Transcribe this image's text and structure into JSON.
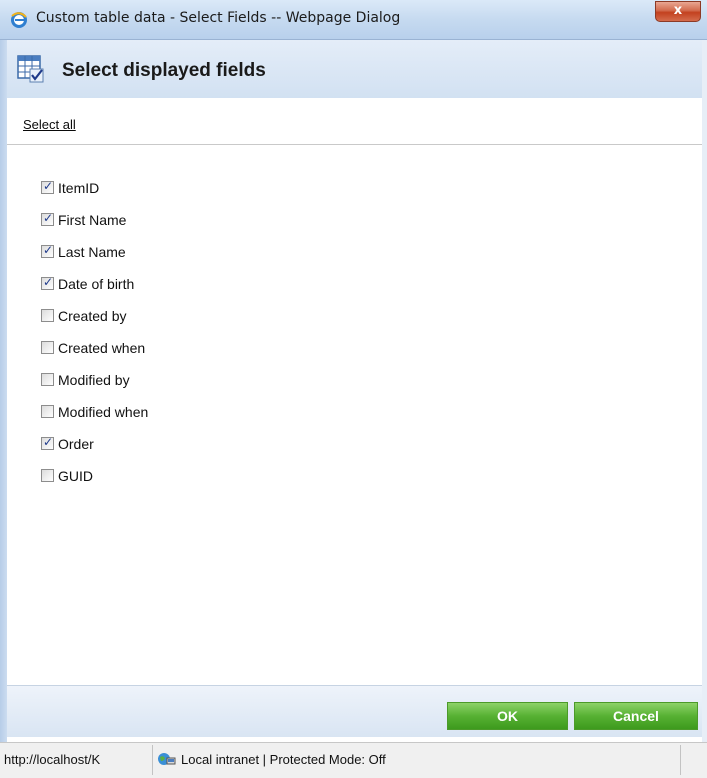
{
  "window": {
    "title": "Custom table data - Select Fields -- Webpage Dialog",
    "close_label": "x"
  },
  "dialog": {
    "title": "Select displayed fields",
    "select_all": "Select all"
  },
  "fields": [
    {
      "label": "ItemID",
      "checked": true
    },
    {
      "label": "First Name",
      "checked": true
    },
    {
      "label": "Last Name",
      "checked": true
    },
    {
      "label": "Date of birth",
      "checked": true
    },
    {
      "label": "Created by",
      "checked": false
    },
    {
      "label": "Created when",
      "checked": false
    },
    {
      "label": "Modified by",
      "checked": false
    },
    {
      "label": "Modified when",
      "checked": false
    },
    {
      "label": "Order",
      "checked": true
    },
    {
      "label": "GUID",
      "checked": false
    }
  ],
  "footer": {
    "ok_label": "OK",
    "cancel_label": "Cancel"
  },
  "status": {
    "url": "http://localhost/K",
    "zone": "Local intranet | Protected Mode: Off"
  },
  "colors": {
    "button_green": "#57b133",
    "header_blue": "#d7e4f3",
    "close_red": "#c3411f"
  }
}
